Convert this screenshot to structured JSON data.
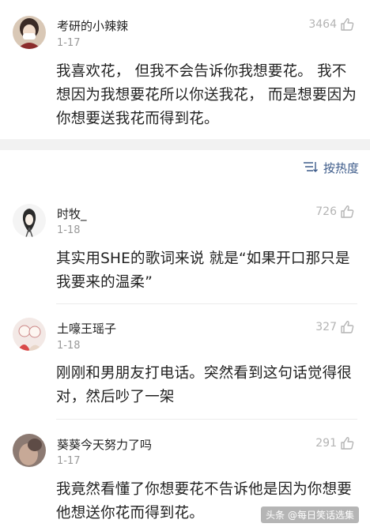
{
  "main_post": {
    "username": "考研的小辣辣",
    "date": "1-17",
    "likes": "3464",
    "text": "我喜欢花， 但我不会告诉你我想要花。 我不想因为我想要花所以你送我花， 而是想要因为你想要送我花而得到花。"
  },
  "sort": {
    "label": "按热度",
    "icon": "sort-lines-icon"
  },
  "comments": [
    {
      "username": "时牧_",
      "date": "1-18",
      "likes": "726",
      "text": "其实用SHE的歌词来说 就是“如果开口那只是 我要来的温柔”"
    },
    {
      "username": "土嚎王瑶子",
      "date": "1-18",
      "likes": "327",
      "text": "刚刚和男朋友打电话。突然看到这句话觉得很对，然后吵了一架"
    },
    {
      "username": "葵葵今天努力了吗",
      "date": "1-17",
      "likes": "291",
      "text": "我竟然看懂了你想要花不告诉他是因为你想要他想送你花而得到花。"
    }
  ],
  "watermark": "头条 @每日笑话选集",
  "colors": {
    "link": "#3d5b8a",
    "muted": "#9a9a9a",
    "band": "#f2f2f2"
  }
}
